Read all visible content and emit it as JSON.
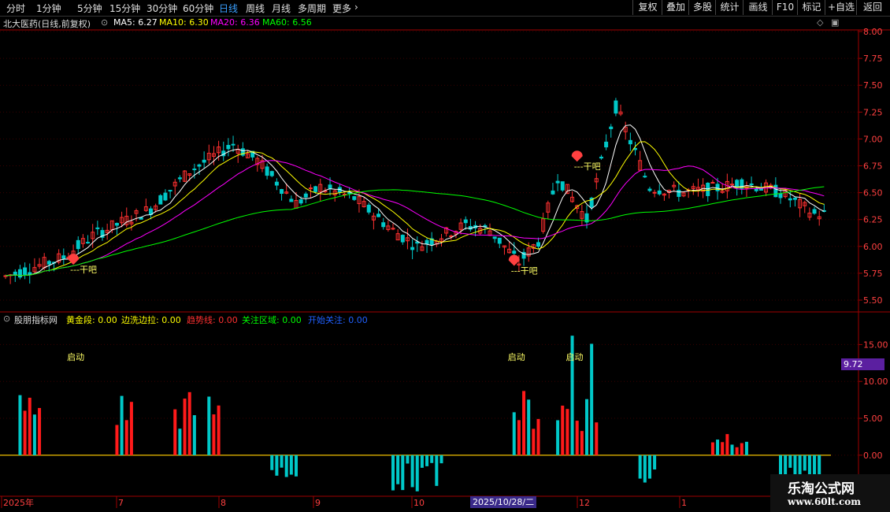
{
  "toolbar": {
    "timeframes": [
      "分时",
      "1分钟",
      "5分钟",
      "15分钟",
      "30分钟",
      "60分钟",
      "日线",
      "周线",
      "月线",
      "多周期",
      "更多"
    ],
    "active_timeframe": "日线",
    "right_buttons": [
      "复权",
      "叠加",
      "多股",
      "统计",
      "画线",
      "F10",
      "标记",
      "+自选",
      "返回"
    ]
  },
  "main_chart": {
    "stock_title": "北大医药(日线,前复权)",
    "ma_labels": [
      {
        "text": "MA5: 6.27",
        "color": "#ffffff"
      },
      {
        "text": "MA10: 6.30",
        "color": "#ffff00"
      },
      {
        "text": "MA20: 6.36",
        "color": "#ff00ff"
      },
      {
        "text": "MA60: 6.56",
        "color": "#00ff00"
      }
    ],
    "price_axis": [
      "8.00",
      "7.75",
      "7.50",
      "7.25",
      "7.00",
      "6.75",
      "6.50",
      "6.25",
      "6.00",
      "5.75",
      "5.50"
    ],
    "signal_label": "---干吧",
    "colors": {
      "up": "#ff3030",
      "down": "#00c8c8",
      "ma5": "#ffffff",
      "ma10": "#ffff00",
      "ma20": "#ff00ff",
      "ma60": "#00ff00"
    }
  },
  "indicator": {
    "name": "股朋指标网",
    "fields": [
      {
        "text": "黄金段: 0.00",
        "color": "#ffff00"
      },
      {
        "text": "边洗边拉: 0.00",
        "color": "#ffff00"
      },
      {
        "text": "趋势线: 0.00",
        "color": "#ff3030"
      },
      {
        "text": "关注区域: 0.00",
        "color": "#00ff00"
      },
      {
        "text": "开始关注: 0.00",
        "color": "#2060ff"
      }
    ],
    "axis": [
      "15.00",
      "10.00",
      "5.00",
      "0.00"
    ],
    "current_value": "9.72",
    "start_label": "启动"
  },
  "date_axis": {
    "labels": [
      "2025年",
      "7",
      "8",
      "9",
      "10",
      "12",
      "1"
    ],
    "selected_date": "2025/10/28/二"
  },
  "watermark": {
    "line1": "乐淘公式网",
    "line2": "www.60lt.com"
  }
}
